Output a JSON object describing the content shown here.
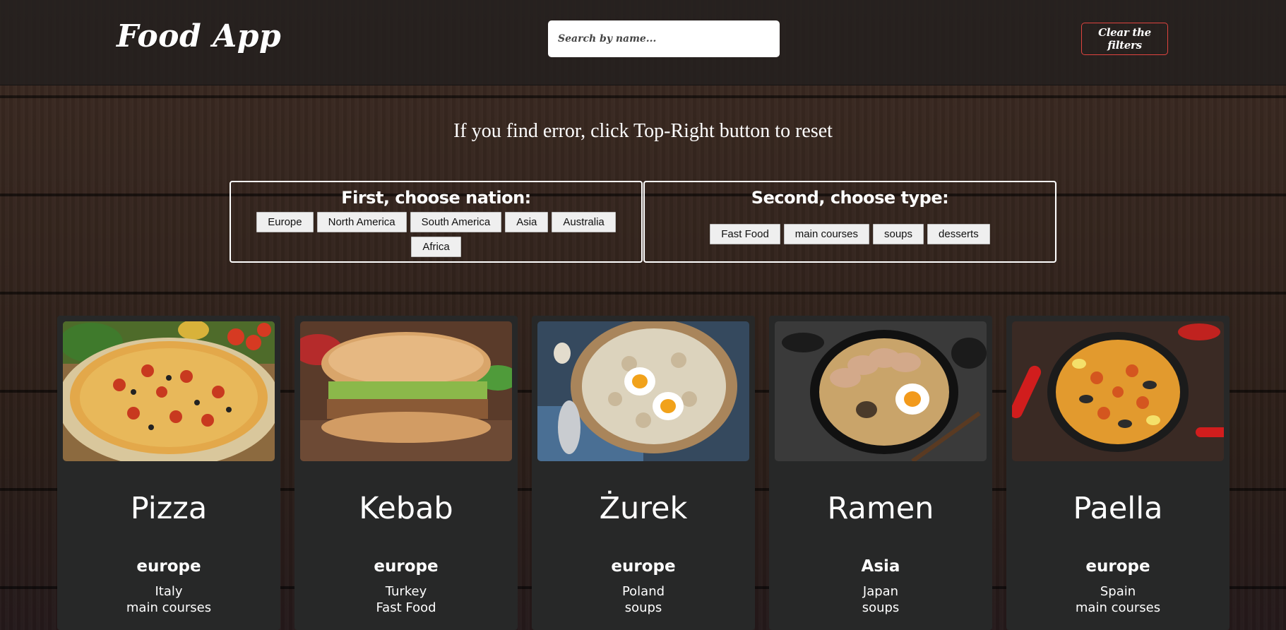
{
  "header": {
    "logo": "Food App",
    "search_placeholder": "Search by name...",
    "clear_button": "Clear the filters"
  },
  "info_text": "If you find error, click Top-Right button to reset",
  "nation_filter": {
    "title": "First, choose nation:",
    "options": [
      "Europe",
      "North America",
      "South America",
      "Asia",
      "Australia",
      "Africa"
    ]
  },
  "type_filter": {
    "title": "Second, choose type:",
    "options": [
      "Fast Food",
      "main courses",
      "soups",
      "desserts"
    ]
  },
  "cards": [
    {
      "name": "Pizza",
      "region": "europe",
      "country": "Italy",
      "type": "main courses",
      "image": "pizza-photo"
    },
    {
      "name": "Kebab",
      "region": "europe",
      "country": "Turkey",
      "type": "Fast Food",
      "image": "kebab-photo"
    },
    {
      "name": "Żurek",
      "region": "europe",
      "country": "Poland",
      "type": "soups",
      "image": "zurek-photo"
    },
    {
      "name": "Ramen",
      "region": "Asia",
      "country": "Japan",
      "type": "soups",
      "image": "ramen-photo"
    },
    {
      "name": "Paella",
      "region": "europe",
      "country": "Spain",
      "type": "main courses",
      "image": "paella-photo"
    }
  ],
  "colors": {
    "header_bg": "#232120",
    "card_bg": "#272828",
    "clear_button_border": "#e0443f",
    "chip_bg": "#efefef"
  }
}
